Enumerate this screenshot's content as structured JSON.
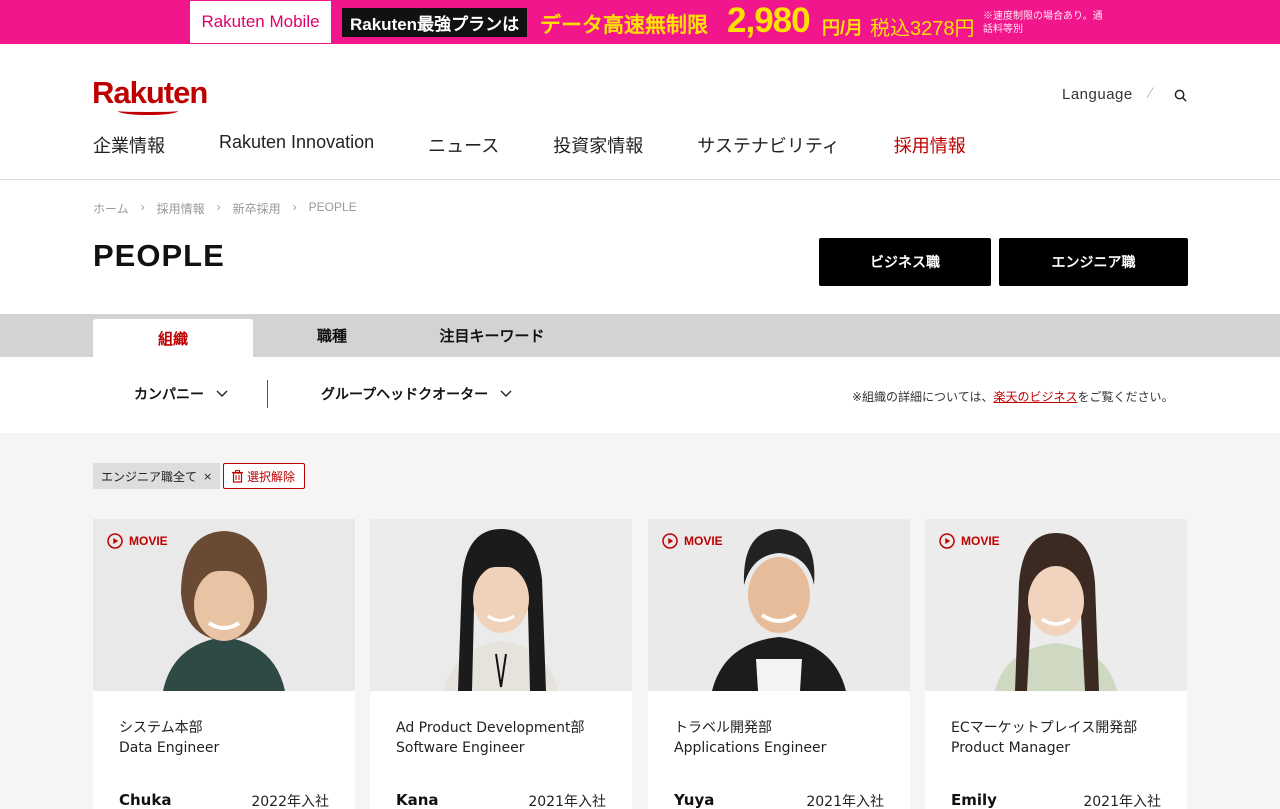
{
  "promo": {
    "brand": "Rakuten Mobile",
    "plan": "Rakuten最強プランは",
    "headline": "データ高速無制限",
    "price": "2,980",
    "unit": "円/月",
    "tax": "税込3278円",
    "note": "※速度制限の場合あり。通話料等別"
  },
  "header": {
    "logo": "Rakuten",
    "language": "Language",
    "nav": [
      "企業情報",
      "Rakuten Innovation",
      "ニュース",
      "投資家情報",
      "サステナビリティ",
      "採用情報"
    ]
  },
  "breadcrumb": [
    "ホーム",
    "採用情報",
    "新卒採用",
    "PEOPLE"
  ],
  "page_title": "PEOPLE",
  "buttons": {
    "business": "ビジネス職",
    "engineer": "エンジニア職"
  },
  "tabs": [
    "組織",
    "職種",
    "注目キーワード"
  ],
  "filters": {
    "company": "カンパニー",
    "hq": "グループヘッドクオーター",
    "note_prefix": "※組織の詳細については、",
    "note_link": "楽天のビジネス",
    "note_suffix": "をご覧ください。"
  },
  "chips": {
    "tag": "エンジニア職全て",
    "clear": "選択解除"
  },
  "cards": [
    {
      "movie": "MOVIE",
      "dept": "システム本部",
      "role": "Data Engineer",
      "name": "Chuka",
      "year": "2022年入社"
    },
    {
      "movie": "",
      "dept": "Ad Product Development部",
      "role": "Software Engineer",
      "name": "Kana",
      "year": "2021年入社"
    },
    {
      "movie": "MOVIE",
      "dept": "トラベル開発部",
      "role": "Applications Engineer",
      "name": "Yuya",
      "year": "2021年入社"
    },
    {
      "movie": "MOVIE",
      "dept": "ECマーケットプレイス開発部",
      "role": "Product Manager",
      "name": "Emily",
      "year": "2021年入社"
    }
  ],
  "colors": {
    "accent": "#bf0000",
    "promo": "#f2168c"
  }
}
